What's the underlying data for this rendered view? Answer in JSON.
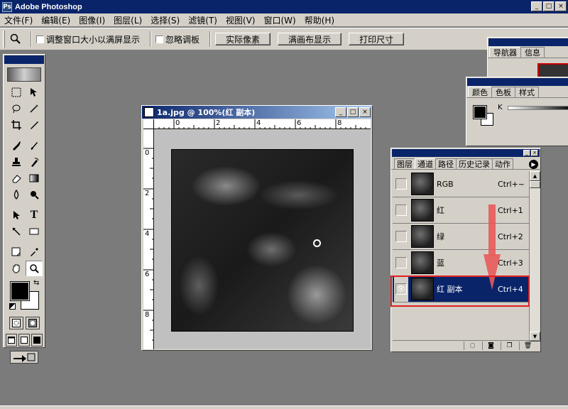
{
  "app": {
    "title": "Adobe Photoshop"
  },
  "window_controls": {
    "minimize": "_",
    "maximize": "□",
    "close": "×"
  },
  "menubar": [
    {
      "label": "文件(F)"
    },
    {
      "label": "编辑(E)"
    },
    {
      "label": "图像(I)"
    },
    {
      "label": "图层(L)"
    },
    {
      "label": "选择(S)"
    },
    {
      "label": "滤镜(T)"
    },
    {
      "label": "视图(V)"
    },
    {
      "label": "窗口(W)"
    },
    {
      "label": "帮助(H)"
    }
  ],
  "options": {
    "tool_icon": "magnifier-icon",
    "resize_window_label": "调整窗口大小以满屏显示",
    "ignore_palettes_label": "忽略调板",
    "actual_pixels": "实际像素",
    "fit_on_screen": "满画布显示",
    "print_size": "打印尺寸"
  },
  "document": {
    "title": "1a.jpg @ 100%(红 副本)",
    "ruler_top": [
      "0",
      "2",
      "4",
      "6",
      "8"
    ],
    "ruler_left": [
      "0",
      "2",
      "4",
      "6",
      "8"
    ]
  },
  "navigator_panel": {
    "tabs": [
      "导航器",
      "信息"
    ]
  },
  "color_panel": {
    "tabs": [
      "颜色",
      "色板",
      "样式"
    ],
    "slider_label": "K"
  },
  "channels_panel": {
    "tabs": [
      "图层",
      "通道",
      "路径",
      "历史记录",
      "动作"
    ],
    "rows": [
      {
        "name": "RGB",
        "shortcut": "Ctrl+~",
        "visible": false,
        "selected": false
      },
      {
        "name": "红",
        "shortcut": "Ctrl+1",
        "visible": false,
        "selected": false
      },
      {
        "name": "绿",
        "shortcut": "Ctrl+2",
        "visible": false,
        "selected": false
      },
      {
        "name": "蓝",
        "shortcut": "Ctrl+3",
        "visible": false,
        "selected": false
      },
      {
        "name": "红 副本",
        "shortcut": "Ctrl+4",
        "visible": true,
        "selected": true
      }
    ],
    "eye_glyph": "👁"
  },
  "colors": {
    "title_bar": "#0a246a",
    "chrome": "#d4d0c8",
    "workspace": "#7b7b7b",
    "highlight": "#e02020",
    "arrow": "#e85a5a"
  }
}
